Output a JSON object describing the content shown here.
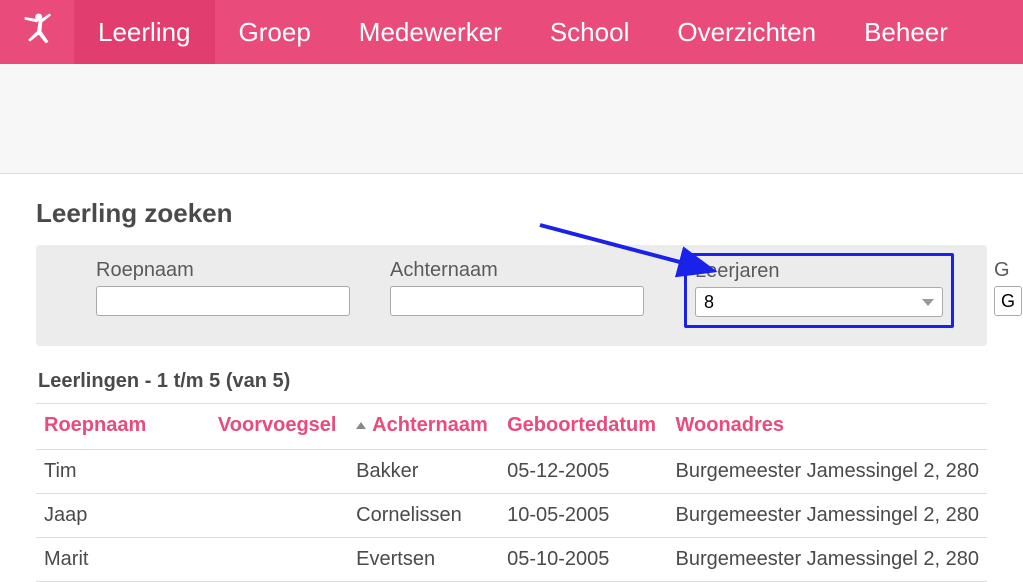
{
  "nav": {
    "items": [
      "Leerling",
      "Groep",
      "Medewerker",
      "School",
      "Overzichten",
      "Beheer"
    ],
    "activeIndex": 0
  },
  "search": {
    "title": "Leerling zoeken",
    "fields": {
      "roepnaam": {
        "label": "Roepnaam",
        "value": ""
      },
      "achternaam": {
        "label": "Achternaam",
        "value": ""
      },
      "leerjaren": {
        "label": "Leerjaren",
        "value": "8"
      },
      "gr": {
        "label": "G",
        "value": "G"
      }
    }
  },
  "results": {
    "title": "Leerlingen - 1 t/m 5 (van 5)",
    "columns": [
      "Roepnaam",
      "Voorvoegsel",
      "Achternaam",
      "Geboortedatum",
      "Woonadres"
    ],
    "rows": [
      {
        "roepnaam": "Tim",
        "voorvoegsel": "",
        "achternaam": "Bakker",
        "geboortedatum": "05-12-2005",
        "woonadres": "Burgemeester Jamessingel 2, 280"
      },
      {
        "roepnaam": "Jaap",
        "voorvoegsel": "",
        "achternaam": "Cornelissen",
        "geboortedatum": "10-05-2005",
        "woonadres": "Burgemeester Jamessingel 2, 280"
      },
      {
        "roepnaam": "Marit",
        "voorvoegsel": "",
        "achternaam": "Evertsen",
        "geboortedatum": "05-10-2005",
        "woonadres": "Burgemeester Jamessingel 2, 280"
      }
    ]
  }
}
